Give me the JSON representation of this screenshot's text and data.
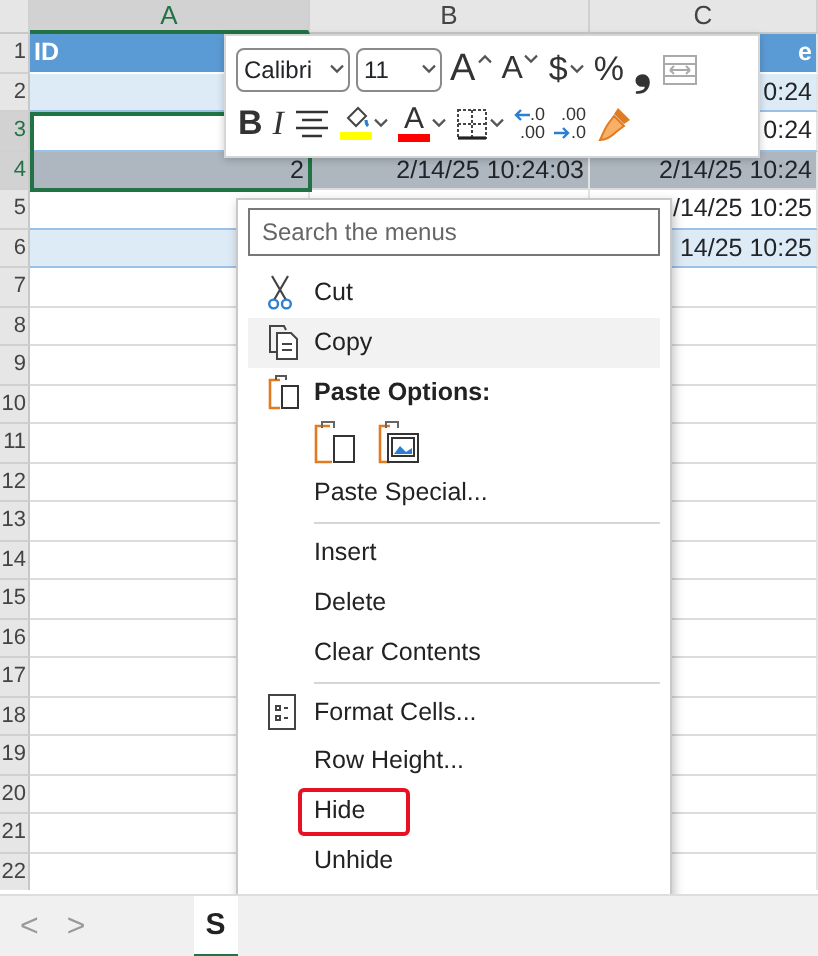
{
  "sheet": {
    "columns": [
      {
        "label": "A",
        "selected": true
      },
      {
        "label": "B",
        "selected": false
      },
      {
        "label": "C",
        "selected": false
      }
    ],
    "rows": [
      {
        "number": "1",
        "kind": "header",
        "selected": false,
        "cells": [
          "ID",
          "",
          "e"
        ]
      },
      {
        "number": "2",
        "kind": "band",
        "selected": false,
        "cells": [
          "",
          "",
          "0:24"
        ]
      },
      {
        "number": "3",
        "kind": "plain",
        "selected": true,
        "cells": [
          "",
          "",
          "0:24"
        ]
      },
      {
        "number": "4",
        "kind": "highlight",
        "selected": true,
        "cells": [
          "2",
          "2/14/25 10:24:03",
          "2/14/25 10:24"
        ]
      },
      {
        "number": "5",
        "kind": "plain",
        "selected": false,
        "cells": [
          "",
          "",
          "/14/25 10:25"
        ]
      },
      {
        "number": "6",
        "kind": "band",
        "selected": false,
        "cells": [
          "",
          "",
          "14/25 10:25"
        ]
      },
      {
        "number": "7",
        "kind": "empty",
        "selected": false,
        "cells": [
          "",
          "",
          ""
        ]
      },
      {
        "number": "8",
        "kind": "empty",
        "selected": false,
        "cells": [
          "",
          "",
          ""
        ]
      },
      {
        "number": "9",
        "kind": "empty",
        "selected": false,
        "cells": [
          "",
          "",
          ""
        ]
      },
      {
        "number": "10",
        "kind": "empty",
        "selected": false,
        "cells": [
          "",
          "",
          ""
        ]
      },
      {
        "number": "11",
        "kind": "empty",
        "selected": false,
        "cells": [
          "",
          "",
          ""
        ]
      },
      {
        "number": "12",
        "kind": "empty",
        "selected": false,
        "cells": [
          "",
          "",
          ""
        ]
      },
      {
        "number": "13",
        "kind": "empty",
        "selected": false,
        "cells": [
          "",
          "",
          ""
        ]
      },
      {
        "number": "14",
        "kind": "empty",
        "selected": false,
        "cells": [
          "",
          "",
          ""
        ]
      },
      {
        "number": "15",
        "kind": "empty",
        "selected": false,
        "cells": [
          "",
          "",
          ""
        ]
      },
      {
        "number": "16",
        "kind": "empty",
        "selected": false,
        "cells": [
          "",
          "",
          ""
        ]
      },
      {
        "number": "17",
        "kind": "empty",
        "selected": false,
        "cells": [
          "",
          "",
          ""
        ]
      },
      {
        "number": "18",
        "kind": "empty",
        "selected": false,
        "cells": [
          "",
          "",
          ""
        ]
      },
      {
        "number": "19",
        "kind": "empty",
        "selected": false,
        "cells": [
          "",
          "",
          ""
        ]
      },
      {
        "number": "20",
        "kind": "empty",
        "selected": false,
        "cells": [
          "",
          "",
          ""
        ]
      },
      {
        "number": "21",
        "kind": "empty",
        "selected": false,
        "cells": [
          "",
          "",
          ""
        ]
      },
      {
        "number": "22",
        "kind": "empty",
        "selected": false,
        "cells": [
          "",
          "",
          ""
        ]
      }
    ]
  },
  "mini_toolbar": {
    "top_row": [
      {
        "kind": "select",
        "value": "Calibri"
      },
      {
        "kind": "select",
        "value": "11"
      },
      {
        "kind": "grow-font",
        "label": "A"
      },
      {
        "kind": "shrink-font",
        "label": "A"
      },
      {
        "kind": "glyph",
        "label": "$",
        "dropdown": true
      },
      {
        "kind": "glyph",
        "label": "%",
        "dropdown": false
      },
      {
        "kind": "glyph",
        "label": "❟",
        "dropdown": false
      },
      {
        "kind": "merge",
        "disabled": true
      }
    ],
    "bottom_row": [
      {
        "kind": "bold",
        "label": "B"
      },
      {
        "kind": "italic",
        "label": "I"
      },
      {
        "kind": "align"
      },
      {
        "kind": "fill-color",
        "color": "#ffff00"
      },
      {
        "kind": "font-color",
        "label": "A",
        "color": "#ff0000"
      },
      {
        "kind": "borders"
      },
      {
        "kind": "increase-decimal",
        "top": ".0",
        "bottom": ".00"
      },
      {
        "kind": "decrease-decimal",
        "top": ".00",
        "bottom": ".0"
      },
      {
        "kind": "painter"
      }
    ]
  },
  "context_menu": {
    "search": {
      "placeholder": "Search the menus"
    },
    "items": [
      {
        "kind": "item",
        "label": "Cut",
        "selected": false,
        "highlighted": false
      },
      {
        "kind": "item",
        "label": "Copy",
        "selected": true,
        "highlighted": false
      },
      {
        "kind": "header",
        "label": "Paste Options:"
      },
      {
        "kind": "paste-icons"
      },
      {
        "kind": "item",
        "label": "Paste Special...",
        "selected": false,
        "highlighted": false
      },
      {
        "kind": "separator"
      },
      {
        "kind": "item",
        "label": "Insert",
        "selected": false,
        "highlighted": false
      },
      {
        "kind": "item",
        "label": "Delete",
        "selected": false,
        "highlighted": false
      },
      {
        "kind": "item",
        "label": "Clear Contents",
        "selected": false,
        "highlighted": false
      },
      {
        "kind": "separator"
      },
      {
        "kind": "item",
        "label": "Format Cells...",
        "selected": false,
        "highlighted": false
      },
      {
        "kind": "item",
        "label": "Row Height...",
        "selected": false,
        "highlighted": false
      },
      {
        "kind": "item",
        "label": "Hide",
        "selected": false,
        "highlighted": true
      },
      {
        "kind": "item",
        "label": "Unhide",
        "selected": false,
        "highlighted": false
      }
    ]
  },
  "sheet_tabs": {
    "prev": "<",
    "next": ">",
    "tabs": [
      {
        "label": "S",
        "selected": true
      }
    ]
  }
}
